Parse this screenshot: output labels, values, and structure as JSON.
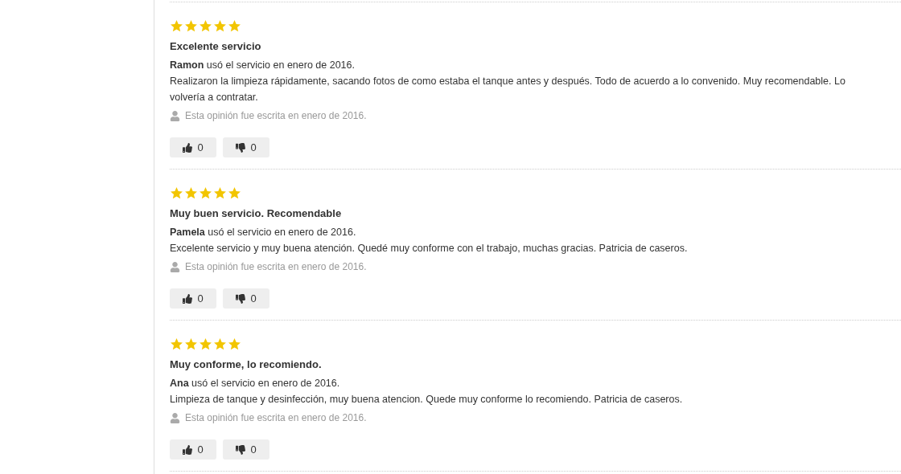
{
  "reviews": [
    {
      "stars": 5,
      "title": "Excelente servicio",
      "author_line": "**Ramon** usó el servicio en enero de 2016.",
      "text": "Realizaron la limpieza rápidamente, sacando fotos de como estaba el tanque antes y después. Todo de acuerdo a lo convenido. Muy recomendable. Lo volvería a contratar.",
      "written": "Esta opinión fue escrita en enero de 2016.",
      "likes": "0",
      "dislikes": "0"
    },
    {
      "stars": 5,
      "title": "Muy buen servicio. Recomendable",
      "author_line": "**Pamela** usó el servicio en enero de 2016.",
      "text": "Excelente servicio y muy buena atención. Quedé muy conforme con el trabajo, muchas gracias. Patricia de caseros.",
      "written": "Esta opinión fue escrita en enero de 2016.",
      "likes": "0",
      "dislikes": "0"
    },
    {
      "stars": 5,
      "title": "Muy conforme, lo recomiendo.",
      "author_line": "**Ana** usó el servicio en enero de 2016.",
      "text": "Limpieza de tanque y desinfección, muy buena atencion. Quede muy conforme lo recomiendo. Patricia de caseros.",
      "written": "Esta opinión fue escrita en enero de 2016.",
      "likes": "0",
      "dislikes": "0"
    }
  ]
}
